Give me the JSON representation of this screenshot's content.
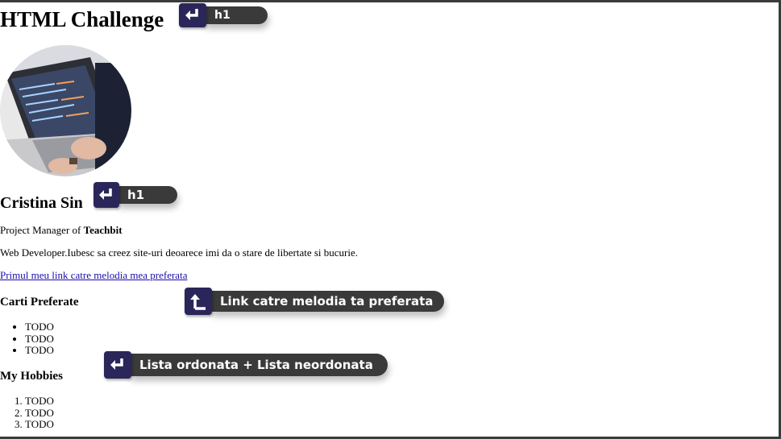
{
  "page": {
    "title": "HTML Challenge",
    "name": "Cristina Sin",
    "role_prefix": "Project Manager of ",
    "role_company": "Teachbit",
    "bio": "Web Developer.Iubesc sa creez site-uri deoarece imi da o stare de libertate si bucurie.",
    "link_text": "Primul meu link catre melodia mea preferata",
    "books_heading": "Carti Preferate",
    "books": [
      "TODO",
      "TODO",
      "TODO"
    ],
    "hobbies_heading": "My Hobbies",
    "hobbies": [
      "TODO",
      "TODO",
      "TODO"
    ]
  },
  "annotations": {
    "title_tag": "h1",
    "name_tag": "h1",
    "link_note": "Link catre melodia ta preferata",
    "lists_note": "Lista ordonata + Lista neordonata"
  },
  "colors": {
    "annotation_box": "#2a2659",
    "annotation_pill": "#3a3a3a",
    "link": "#1a0dab"
  },
  "icons": {
    "title_arrow": "return-arrow-icon",
    "name_arrow": "return-arrow-icon",
    "link_arrow": "up-left-arrow-icon",
    "lists_arrow": "return-arrow-icon"
  }
}
